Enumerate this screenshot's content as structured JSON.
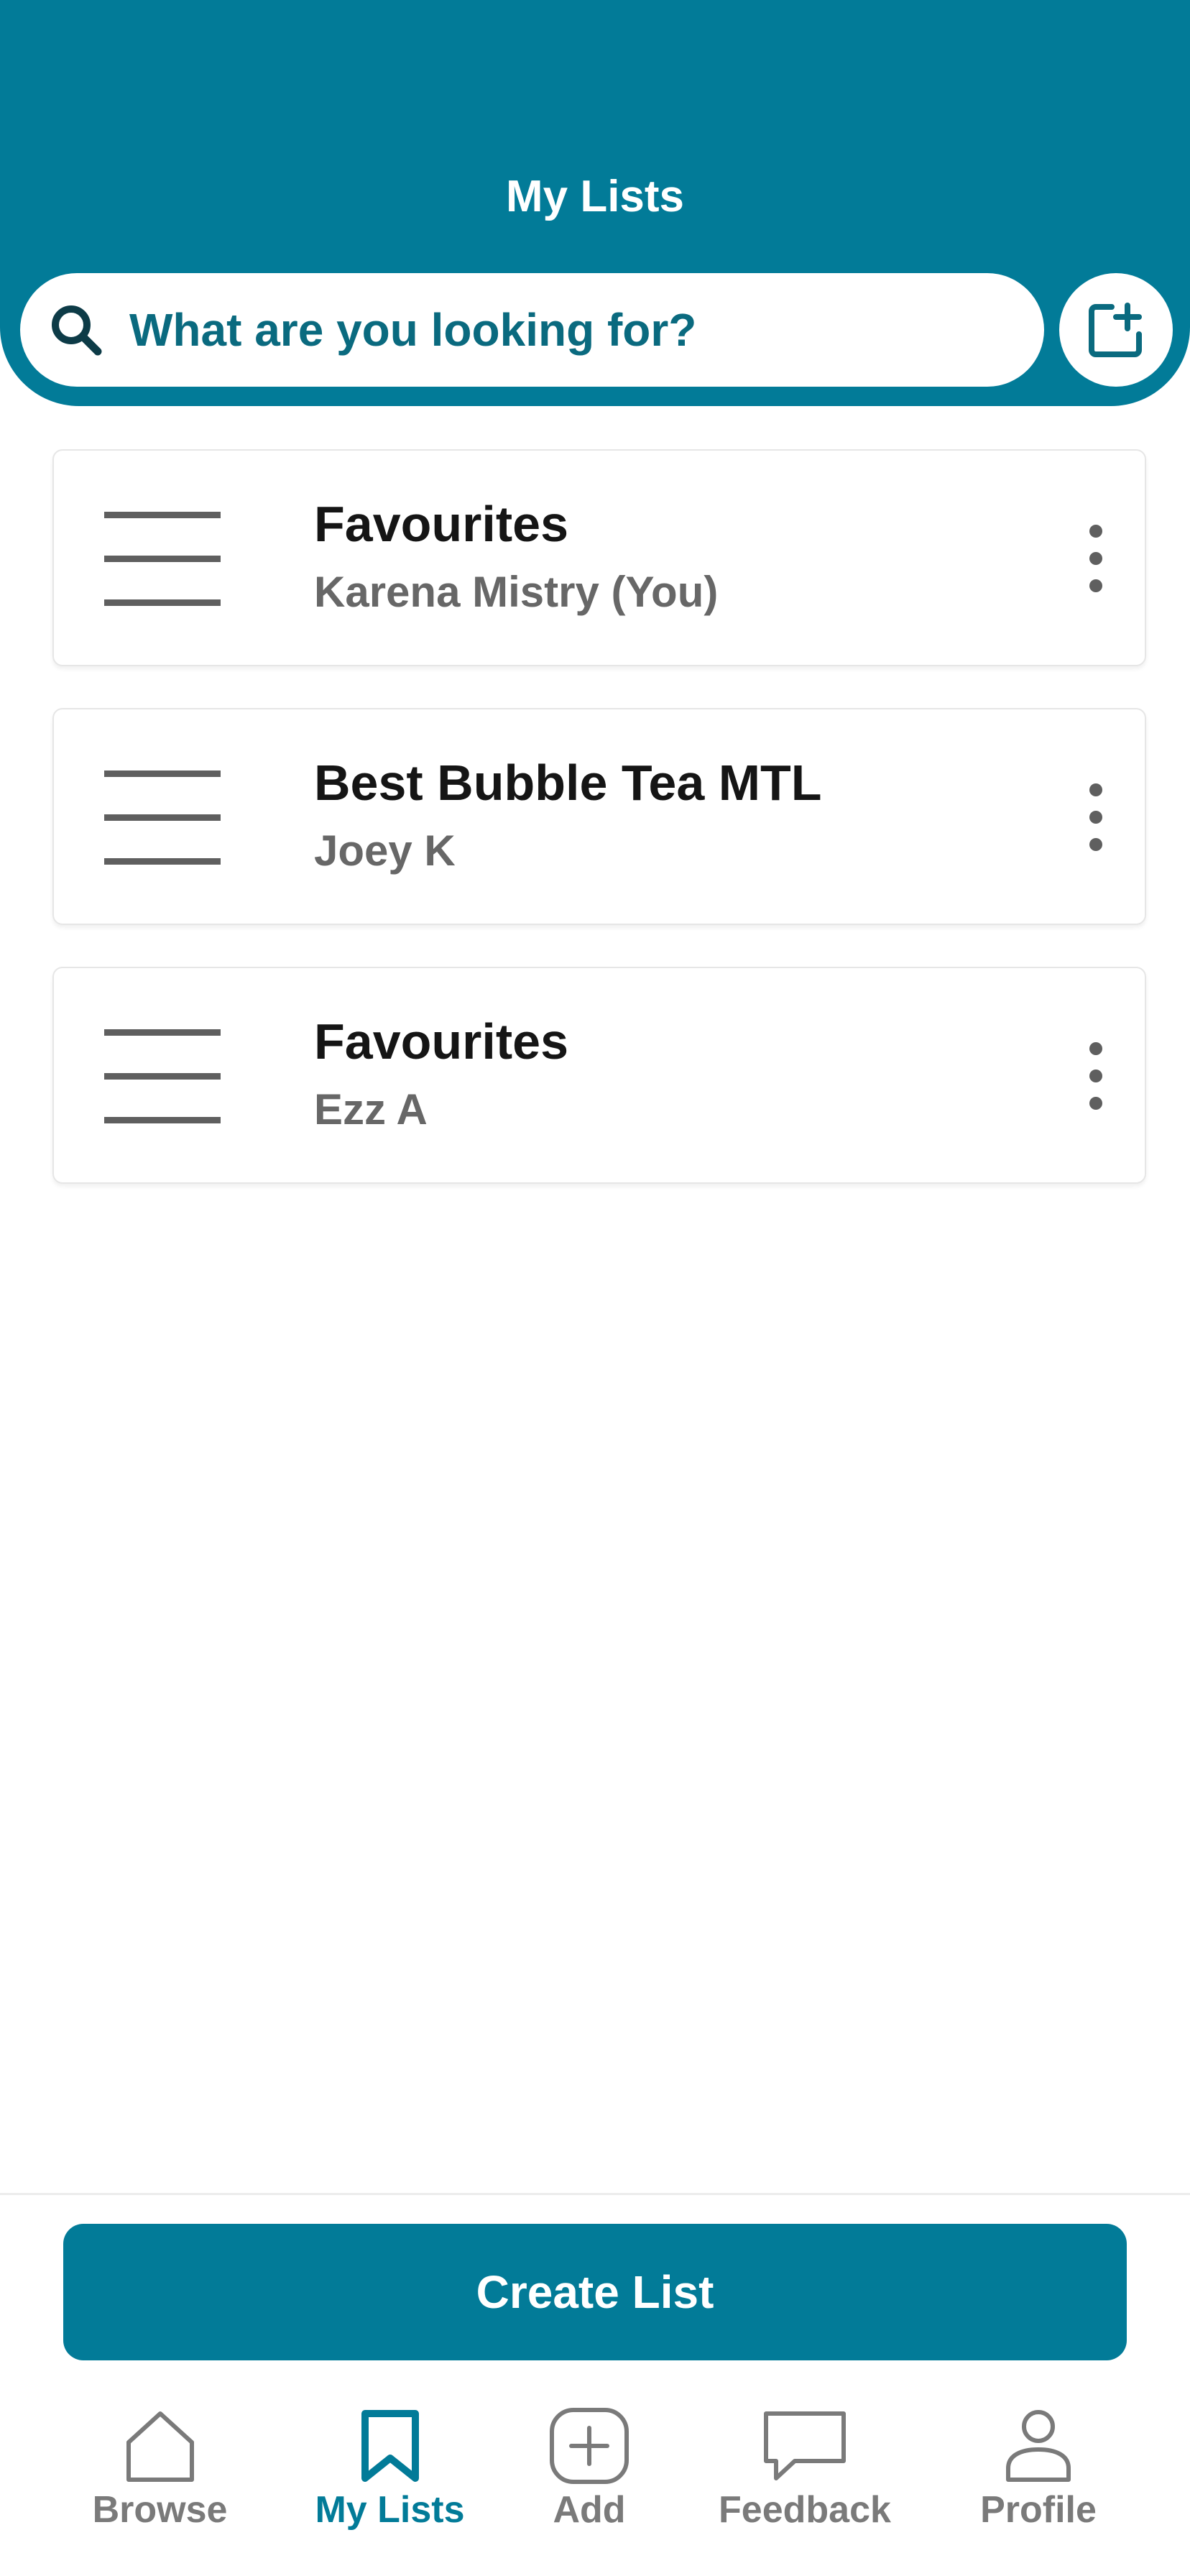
{
  "header": {
    "title": "My Lists"
  },
  "search": {
    "placeholder": "What are you looking for?",
    "icon": "search-icon"
  },
  "new_list_button": {
    "icon": "new-list-icon"
  },
  "lists": [
    {
      "title": "Favourites",
      "owner": "Karena Mistry (You)"
    },
    {
      "title": "Best Bubble Tea MTL",
      "owner": "Joey K"
    },
    {
      "title": "Favourites",
      "owner": "Ezz A"
    }
  ],
  "create_button": {
    "label": "Create List"
  },
  "tabs": [
    {
      "label": "Browse",
      "icon": "home-icon",
      "active": false
    },
    {
      "label": "My Lists",
      "icon": "bookmark-icon",
      "active": true
    },
    {
      "label": "Add",
      "icon": "plus-circle-icon",
      "active": false
    },
    {
      "label": "Feedback",
      "icon": "chat-bubble-icon",
      "active": false
    },
    {
      "label": "Profile",
      "icon": "person-icon",
      "active": false
    }
  ],
  "colors": {
    "accent": "#027b98",
    "text_primary": "#151515",
    "text_secondary": "#676767",
    "tab_inactive": "#7a7a7a"
  }
}
